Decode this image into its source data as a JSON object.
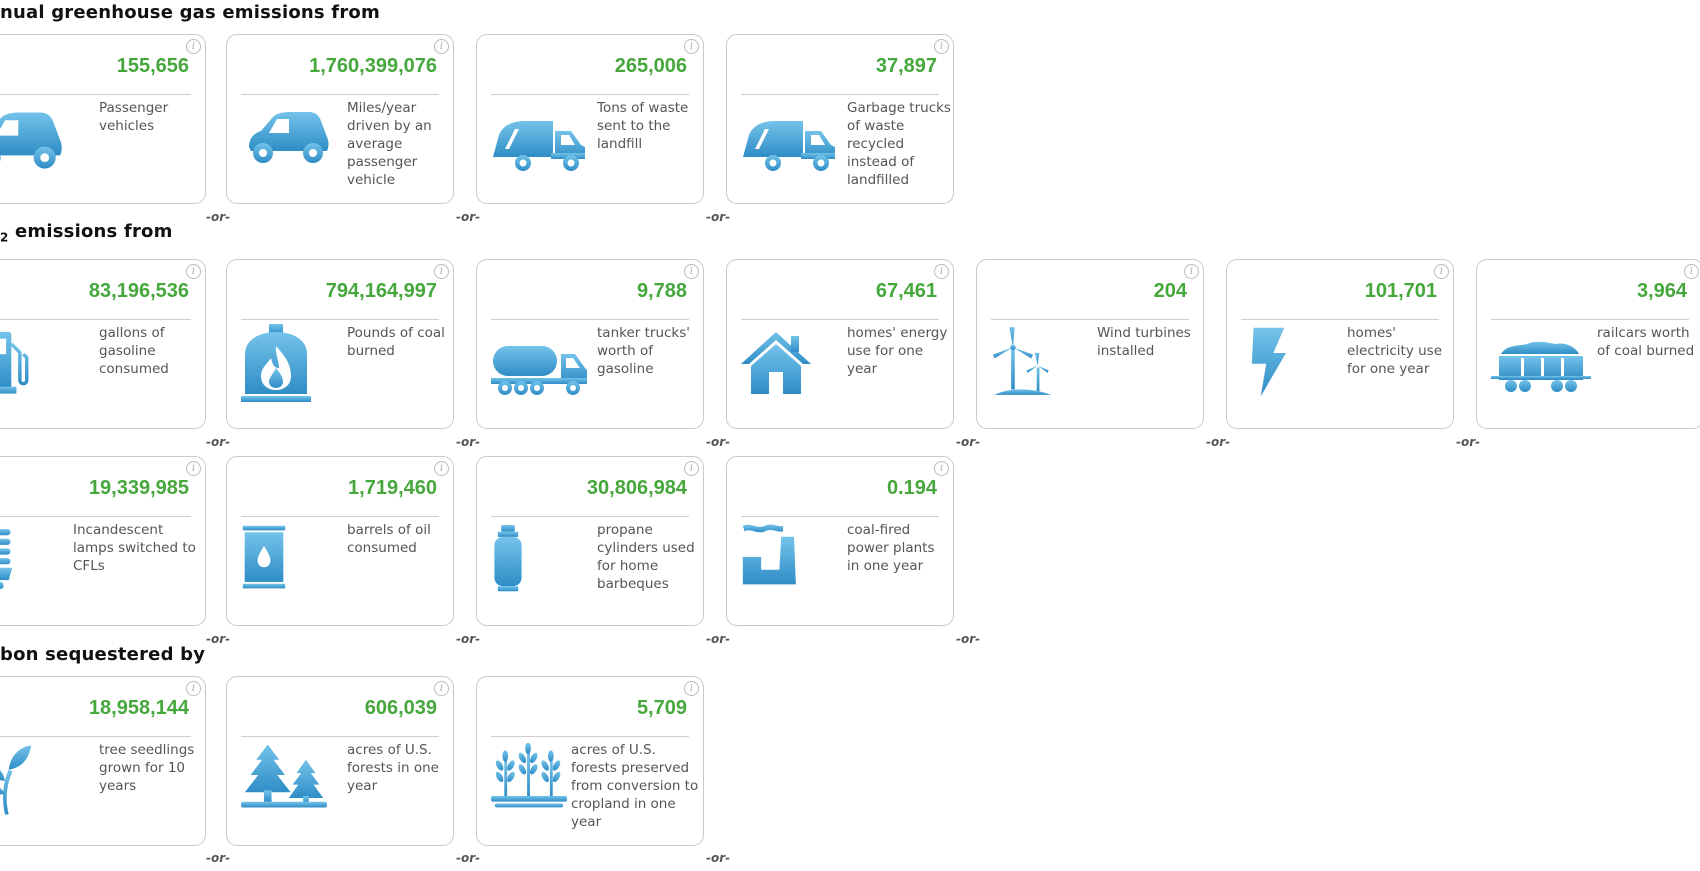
{
  "colors": {
    "value_green": "#46a83c",
    "icon_blue": "#3d9fd3"
  },
  "sections": [
    {
      "title": "nual greenhouse gas emissions from"
    },
    {
      "title_pre": "",
      "subscript": "2",
      "title_post": " emissions from"
    },
    {
      "title": "bon sequestered by"
    }
  ],
  "separator": "-or-",
  "info_icon": "i",
  "cards": [
    {
      "value": "155,656",
      "desc": "Passenger vehicles",
      "icon": "car-icon"
    },
    {
      "value": "1,760,399,076",
      "desc": "Miles/year driven by an average passenger vehicle",
      "icon": "car-icon"
    },
    {
      "value": "265,006",
      "desc": "Tons of waste sent to the landfill",
      "icon": "garbage-truck-icon"
    },
    {
      "value": "37,897",
      "desc": "Garbage trucks of waste recycled instead of landfilled",
      "icon": "garbage-truck-icon"
    },
    {
      "value": "83,196,536",
      "desc": "gallons of gasoline consumed",
      "icon": "gas-pump-icon"
    },
    {
      "value": "794,164,997",
      "desc": "Pounds of coal burned",
      "icon": "fire-icon"
    },
    {
      "value": "9,788",
      "desc": "tanker trucks' worth of gasoline",
      "icon": "tanker-truck-icon"
    },
    {
      "value": "67,461",
      "desc": "homes' energy use for one year",
      "icon": "house-icon"
    },
    {
      "value": "204",
      "desc": "Wind turbines installed",
      "icon": "wind-turbine-icon"
    },
    {
      "value": "101,701",
      "desc": "homes' electricity use for one year",
      "icon": "lightning-icon"
    },
    {
      "value": "3,964",
      "desc": "railcars worth of coal burned",
      "icon": "railcar-icon"
    },
    {
      "value": "19,339,985",
      "desc": "Incandescent lamps switched to CFLs",
      "icon": "cfl-bulb-icon"
    },
    {
      "value": "1,719,460",
      "desc": "barrels of oil consumed",
      "icon": "oil-barrel-icon"
    },
    {
      "value": "30,806,984",
      "desc": "propane cylinders used for home barbeques",
      "icon": "propane-cylinder-icon"
    },
    {
      "value": "0.194",
      "desc": "coal-fired power plants in one year",
      "icon": "power-plant-icon"
    },
    {
      "value": "18,958,144",
      "desc": "tree seedlings grown for 10 years",
      "icon": "seedling-icon"
    },
    {
      "value": "606,039",
      "desc": "acres of U.S. forests in one year",
      "icon": "trees-icon"
    },
    {
      "value": "5,709",
      "desc": "acres of U.S. forests preserved from conversion to cropland in one year",
      "icon": "crops-icon"
    }
  ]
}
